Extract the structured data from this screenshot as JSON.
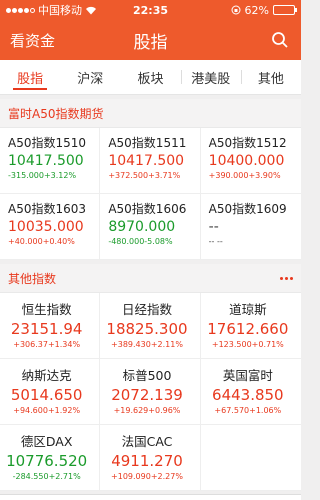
{
  "status": {
    "carrier": "中国移动",
    "time": "22:35",
    "battery": "62%",
    "battery_level": 0.62
  },
  "nav": {
    "back_label": "看资金",
    "title": "股指"
  },
  "tabs": [
    {
      "label": "股指"
    },
    {
      "label": "沪深"
    },
    {
      "label": "板块"
    },
    {
      "label": "港美股"
    },
    {
      "label": "其他"
    }
  ],
  "sections": {
    "futures": {
      "title": "富时A50指数期货",
      "items": [
        {
          "name": "A50指数1510",
          "value": "10417.500",
          "change": "-315.000+3.12%"
        },
        {
          "name": "A50指数1511",
          "value": "10417.500",
          "change": "+372.500+3.71%"
        },
        {
          "name": "A50指数1512",
          "value": "10400.000",
          "change": "+390.000+3.90%"
        },
        {
          "name": "A50指数1603",
          "value": "10035.000",
          "change": "+40.000+0.40%"
        },
        {
          "name": "A50指数1606",
          "value": "8970.000",
          "change": "-480.000-5.08%"
        },
        {
          "name": "A50指数1609",
          "value": "--",
          "change": "-- --"
        }
      ]
    },
    "other": {
      "title": "其他指数",
      "items": [
        {
          "name": "恒生指数",
          "value": "23151.94",
          "change": "+306.37+1.34%"
        },
        {
          "name": "日经指数",
          "value": "18825.300",
          "change": "+389.430+2.11%"
        },
        {
          "name": "道琼斯",
          "value": "17612.660",
          "change": "+123.500+0.71%"
        },
        {
          "name": "纳斯达克",
          "value": "5014.650",
          "change": "+94.600+1.92%"
        },
        {
          "name": "标普500",
          "value": "2072.139",
          "change": "+19.629+0.96%"
        },
        {
          "name": "英国富时",
          "value": "6443.850",
          "change": "+67.570+1.06%"
        },
        {
          "name": "德区DAX",
          "value": "10776.520",
          "change": "-284.550+2.71%"
        },
        {
          "name": "法国CAC",
          "value": "4911.270",
          "change": "+109.090+2.27%"
        }
      ]
    }
  }
}
